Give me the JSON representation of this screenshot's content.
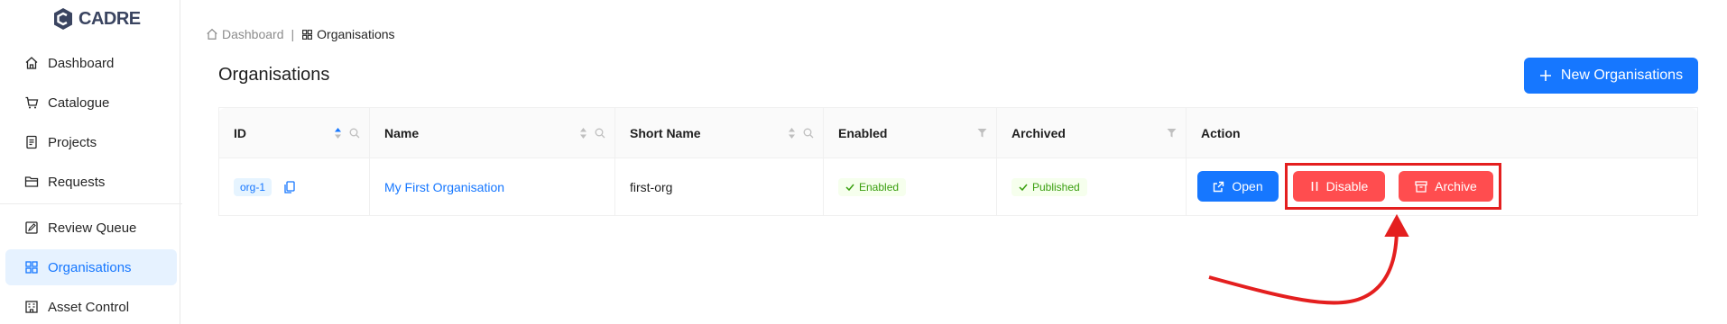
{
  "app": {
    "logo_text": "CADRE"
  },
  "sidebar": {
    "items": [
      {
        "label": "Dashboard",
        "icon": "home-icon"
      },
      {
        "label": "Catalogue",
        "icon": "cart-icon"
      },
      {
        "label": "Projects",
        "icon": "document-icon"
      },
      {
        "label": "Requests",
        "icon": "folder-icon"
      },
      {
        "label": "Review Queue",
        "icon": "edit-icon"
      },
      {
        "label": "Organisations",
        "icon": "apps-icon",
        "active": true
      },
      {
        "label": "Asset Control",
        "icon": "building-icon"
      }
    ]
  },
  "breadcrumb": {
    "home": "Dashboard",
    "separator": "|",
    "current": "Organisations"
  },
  "page": {
    "title": "Organisations",
    "new_button": "New Organisations"
  },
  "table": {
    "columns": [
      "ID",
      "Name",
      "Short Name",
      "Enabled",
      "Archived",
      "Action"
    ],
    "rows": [
      {
        "id": "org-1",
        "name": "My First Organisation",
        "short_name": "first-org",
        "enabled": "Enabled",
        "archived": "Published"
      }
    ],
    "actions": {
      "open": "Open",
      "disable": "Disable",
      "archive": "Archive"
    }
  },
  "colors": {
    "primary": "#1677ff",
    "danger": "#ff4d4f",
    "annotation": "#e41f1f",
    "success": "#389e0d"
  }
}
